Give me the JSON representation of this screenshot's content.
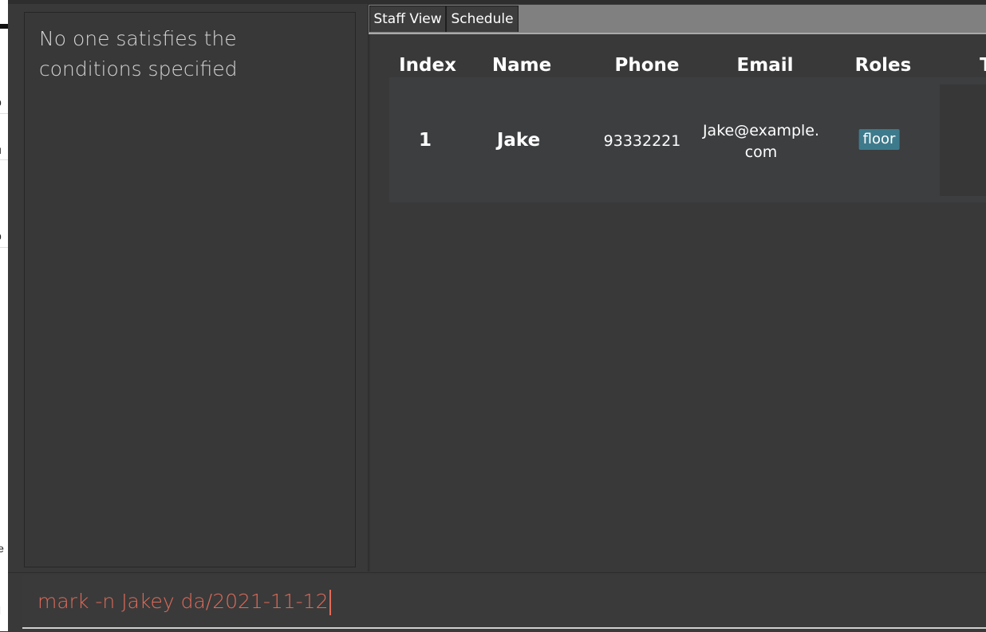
{
  "background_window": {
    "fragments": [
      "p",
      "u",
      "p",
      "le",
      "r",
      "fl"
    ]
  },
  "result_display": {
    "message": "No one satisfies the conditions specified"
  },
  "tabs": [
    {
      "label": "Staff View",
      "active": true
    },
    {
      "label": "Schedule",
      "active": false
    }
  ],
  "staff_table": {
    "columns": [
      "Index",
      "Name",
      "Phone",
      "Email",
      "Roles",
      "T"
    ],
    "rows": [
      {
        "index": "1",
        "name": "Jake",
        "phone": "93332221",
        "email": "Jake@example.com",
        "roles": [
          "floor"
        ]
      }
    ]
  },
  "command_box": {
    "value": "mark -n Jakey da/2021-11-12"
  },
  "colors": {
    "app_background": "#393939",
    "role_badge": "#3d7a8c",
    "command_text": "#e06b5a",
    "tab_header": "#808080"
  }
}
